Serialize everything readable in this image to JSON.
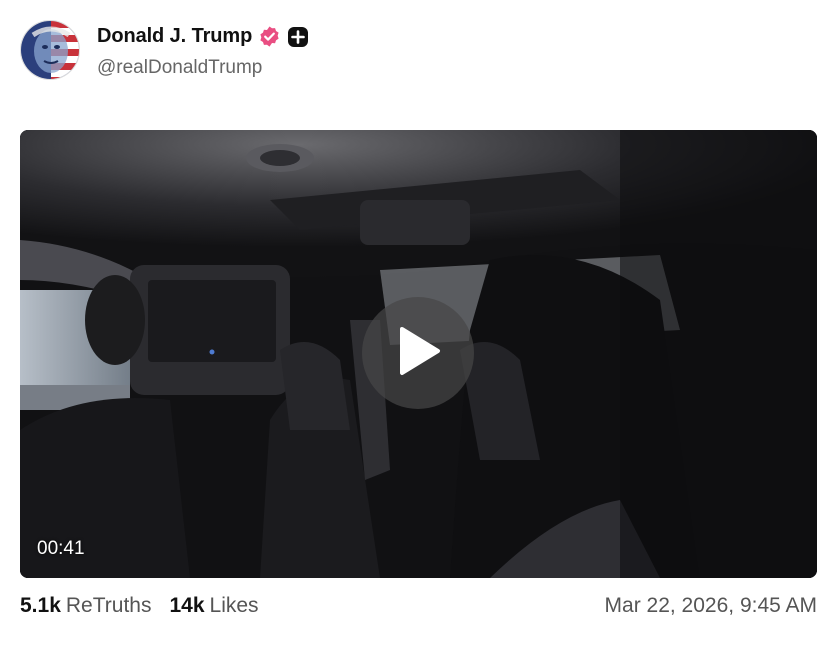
{
  "post": {
    "author": {
      "display_name": "Donald J. Trump",
      "handle": "@realDonaldTrump",
      "verified_icon": "verified-badge-icon",
      "plus_icon": "plus-badge-icon",
      "badge_color": "#e94e82"
    },
    "video": {
      "duration": "00:41",
      "play_icon": "play-icon"
    },
    "stats": {
      "retruths_count": "5.1k",
      "retruths_label": "ReTruths",
      "likes_count": "14k",
      "likes_label": "Likes"
    },
    "timestamp": "Mar 22, 2026, 9:45 AM"
  }
}
